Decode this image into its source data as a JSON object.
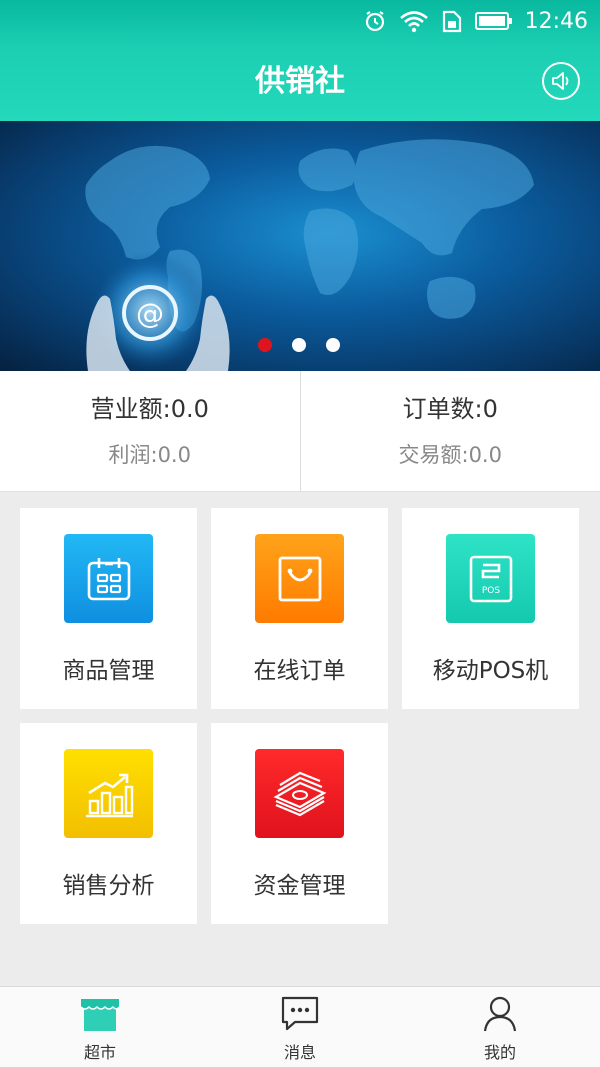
{
  "status_bar": {
    "time": "12:46"
  },
  "header": {
    "title": "供销社"
  },
  "banner": {
    "slide_count": 3,
    "active_slide": 1
  },
  "stats": {
    "revenue": "营业额:0.0",
    "profit": "利润:0.0",
    "orders": "订单数:0",
    "transactions": "交易额:0.0"
  },
  "tiles": [
    {
      "label": "商品管理",
      "icon": "calendar-grid-icon",
      "color": "#1aa3ee"
    },
    {
      "label": "在线订单",
      "icon": "shopping-bag-icon",
      "color": "#ff8a00"
    },
    {
      "label": "移动POS机",
      "icon": "pos-terminal-icon",
      "color": "#1ed4b9"
    },
    {
      "label": "销售分析",
      "icon": "bar-chart-icon",
      "color": "#f4c400"
    },
    {
      "label": "资金管理",
      "icon": "money-stack-icon",
      "color": "#ee1c24"
    }
  ],
  "tabbar": [
    {
      "label": "超市",
      "icon": "store-icon",
      "active": true
    },
    {
      "label": "消息",
      "icon": "message-icon",
      "active": false
    },
    {
      "label": "我的",
      "icon": "user-icon",
      "active": false
    }
  ]
}
